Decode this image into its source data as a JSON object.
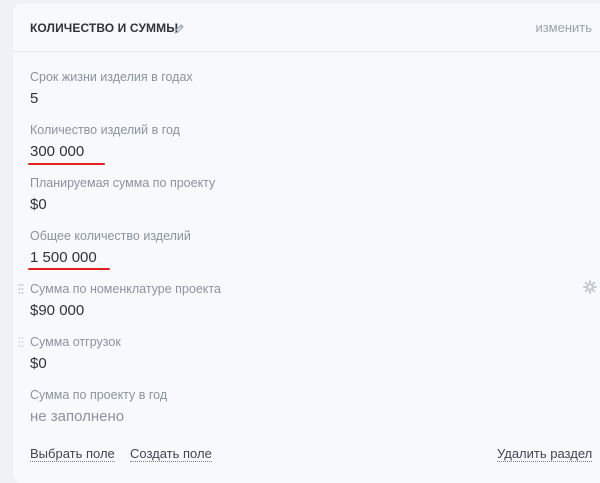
{
  "section": {
    "title": "КОЛИЧЕСТВО И СУММЫ",
    "edit_label": "изменить"
  },
  "fields": [
    {
      "label": "Срок жизни изделия в годах",
      "value": "5"
    },
    {
      "label": "Количество изделий в год",
      "value": "300 000"
    },
    {
      "label": "Планируемая сумма по проекту",
      "value": "$0"
    },
    {
      "label": "Общее количество изделий",
      "value": "1 500 000"
    },
    {
      "label": "Сумма по номенклатуре проекта",
      "value": "$90 000"
    },
    {
      "label": "Сумма отгрузок",
      "value": "$0"
    },
    {
      "label": "Сумма по проекту в год",
      "value": "не заполнено"
    }
  ],
  "footer": {
    "choose_field": "Выбрать поле",
    "create_field": "Создать поле",
    "delete_section": "Удалить раздел"
  },
  "colors": {
    "annotation_underline": "#e0211f",
    "label": "#8b939c",
    "value": "#2f3237"
  },
  "icons": {
    "title": "pencil-icon",
    "row_settings": "gear-icon",
    "row_drag": "drag-handle-icon"
  }
}
